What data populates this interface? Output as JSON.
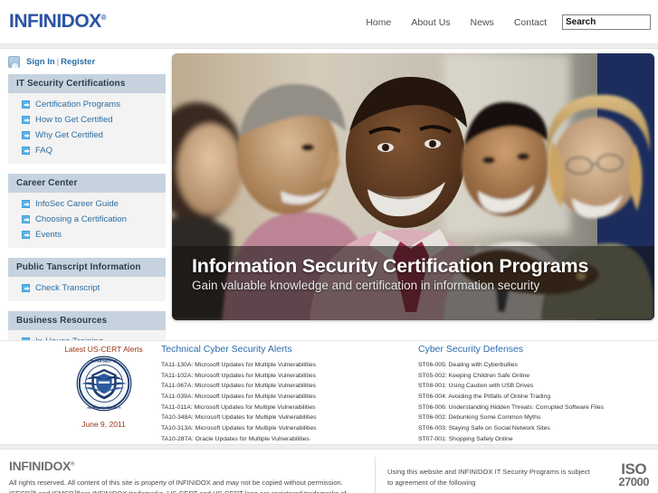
{
  "header": {
    "logo": "INFINIDOX",
    "logo_reg": "®",
    "nav": [
      {
        "label": "Home"
      },
      {
        "label": "About Us"
      },
      {
        "label": "News"
      },
      {
        "label": "Contact"
      }
    ],
    "search": {
      "value": "Search",
      "placeholder": "Search"
    }
  },
  "sidebar": {
    "account": {
      "signin": "Sign In",
      "separator": "|",
      "register": "Register"
    },
    "panels": [
      {
        "title": "IT Security Certifications",
        "items": [
          {
            "label": "Certification Programs"
          },
          {
            "label": "How to Get Certified"
          },
          {
            "label": "Why Get Certified"
          },
          {
            "label": "FAQ"
          }
        ]
      },
      {
        "title": "Career Center",
        "items": [
          {
            "label": "InfoSec Career Guide"
          },
          {
            "label": "Choosing a Certification"
          },
          {
            "label": "Events"
          }
        ]
      },
      {
        "title": "Public Tanscript Information",
        "items": [
          {
            "label": "Check Transcript"
          }
        ]
      },
      {
        "title": "Business Resources",
        "items": [
          {
            "label": "In-House Training"
          }
        ]
      }
    ]
  },
  "hero": {
    "title": "Information Security Certification Programs",
    "subtitle": "Gain valuable knowledge and certification in information security"
  },
  "alerts": {
    "cert_badge": {
      "title": "Latest US-CERT Alerts",
      "date": "June 9, 2011",
      "seal_name": "dhs-seal-icon"
    },
    "technical": {
      "title": "Technical Cyber Security Alerts",
      "items": [
        "TA11-130A: Microsoft Updates for Multiple Vulnerabilities",
        "TA11-102A: Microsoft Updates for Multiple Vulnerabilities",
        "TA11-067A: Microsoft Updates for Multiple Vulnerabilities",
        "TA11-039A: Microsoft Updates for Multiple Vulnerabilities",
        "TA11-011A: Microsoft Updates for Multiple Vulnerabilities",
        "TA10-348A: Microsoft Updates for Multiple Vulnerabilities",
        "TA10-313A: Microsoft Updates for Multiple Vulnerabilities",
        "TA10-287A: Oracle Updates for Multiple Vulnerabilities"
      ]
    },
    "defenses": {
      "title": "Cyber Security Defenses",
      "items": [
        "ST06-005: Dealing with Cyberbullies",
        "ST05-002: Keeping Children Safe Online",
        "ST08-001: Using Caution with USB Drives",
        "ST06-004: Avoiding the Pitfalls of Online Trading",
        "ST06-006: Understanding Hidden Threats: Corrupted Software Files",
        "ST06-002: Debunking Some Common Myths",
        "ST06-003: Staying Safe on Social Network Sites",
        "ST07-001: Shopping Safely Online"
      ]
    }
  },
  "footer": {
    "logo": "INFINIDOX",
    "logo_reg": "®",
    "left_text": "All rights reserved. All content of this site is property of INFINIDOX and may not be copied without permission. ISECP™ and ISMCP™are INFINIDOX trademarks. US-CERT and US-CERT logo are registered trademarks of",
    "right_text": "Using this website and INFINIDOX IT Security Programs is subject to agreement of the following",
    "iso_line1": "ISO",
    "iso_line2": "27000"
  }
}
